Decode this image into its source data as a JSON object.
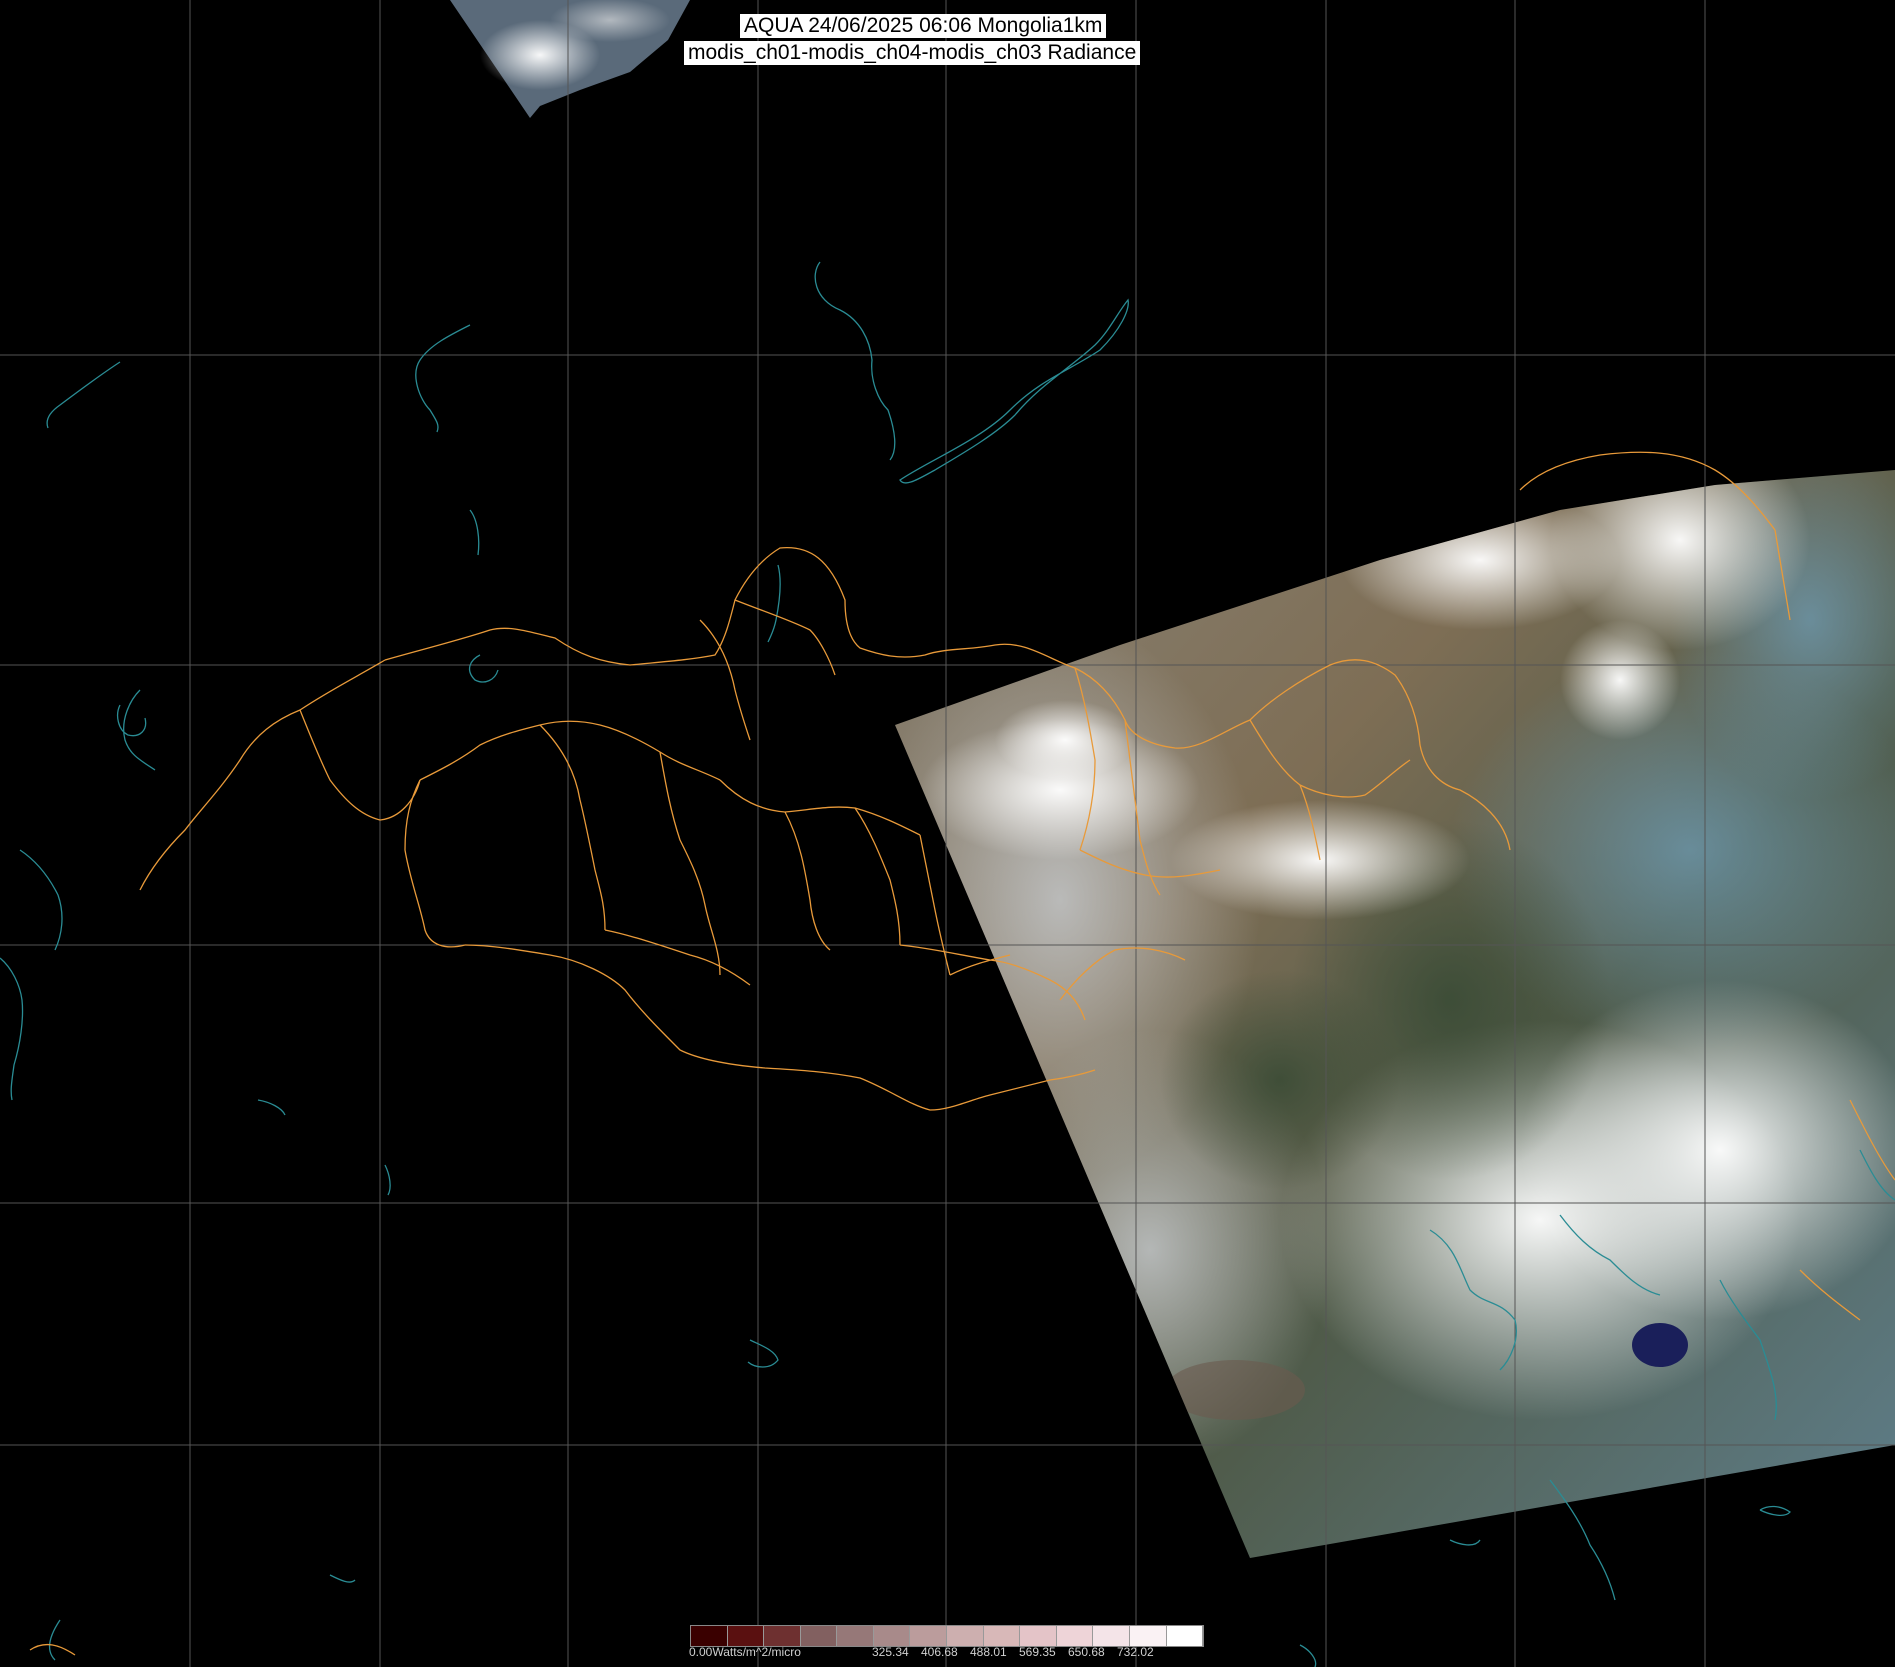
{
  "title": {
    "line1": "AQUA 24/06/2025 06:06 Mongolia1km",
    "line2": "modis_ch01-modis_ch04-modis_ch03 Radiance"
  },
  "colorbar": {
    "unit_label": "0.00Watts/m^2/micro",
    "ticks": [
      "325.34",
      "406.68",
      "488.01",
      "569.35",
      "650.68",
      "732.02"
    ],
    "colors": [
      "#3a0000",
      "#5a1010",
      "#6e3030",
      "#826060",
      "#967878",
      "#a88a8a",
      "#bb9c9c",
      "#cdafaf",
      "#d8b8b8",
      "#e4c4c8",
      "#eed4d8",
      "#f4e4e8",
      "#faf2f4",
      "#ffffff"
    ]
  },
  "colors": {
    "background": "#000000",
    "graticule": "#555555",
    "borders": "#e89a3a",
    "coastline": "#2a8c94"
  }
}
